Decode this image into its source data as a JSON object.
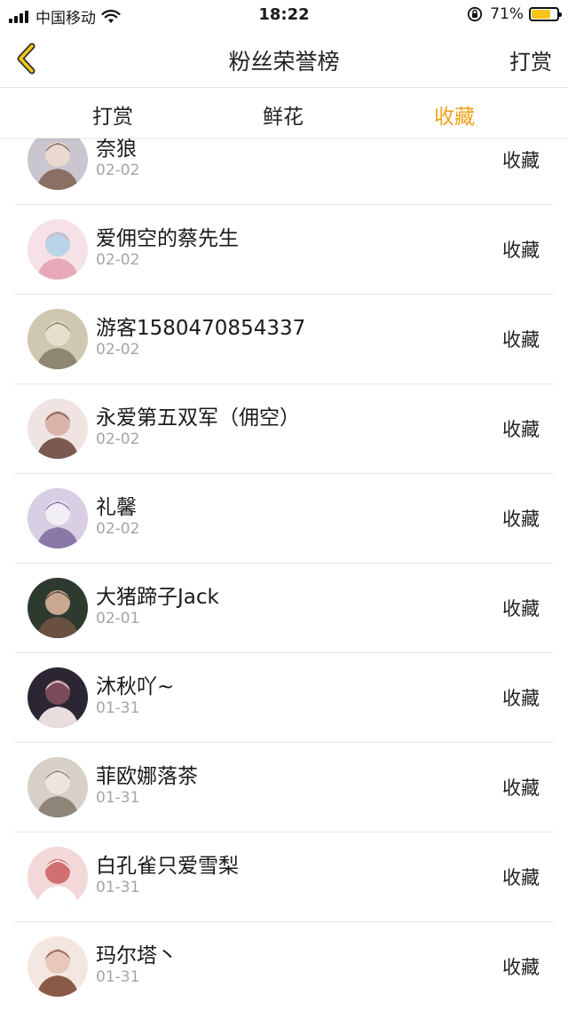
{
  "status_bar": {
    "carrier": "中国移动",
    "time": "18:22",
    "battery_percent": "71%",
    "battery_level": 0.71,
    "signal_bars": 4
  },
  "nav": {
    "title": "粉丝荣誉榜",
    "right_label": "打赏",
    "back_icon": "chevron-left-icon",
    "accent_color": "#f0a21a"
  },
  "tabs": [
    {
      "label": "打赏",
      "active": false
    },
    {
      "label": "鲜花",
      "active": false
    },
    {
      "label": "收藏",
      "active": true
    }
  ],
  "list": {
    "items": [
      {
        "name": "奈狼",
        "date": "02-02",
        "action": "收藏"
      },
      {
        "name": "爱佣空的蔡先生",
        "date": "02-02",
        "action": "收藏"
      },
      {
        "name": "游客1580470854337",
        "date": "02-02",
        "action": "收藏"
      },
      {
        "name": "永爱第五双军（佣空）",
        "date": "02-02",
        "action": "收藏"
      },
      {
        "name": "礼馨",
        "date": "02-02",
        "action": "收藏"
      },
      {
        "name": "大猪蹄子Jack",
        "date": "02-01",
        "action": "收藏"
      },
      {
        "name": "沐秋吖~",
        "date": "01-31",
        "action": "收藏"
      },
      {
        "name": "菲欧娜落茶",
        "date": "01-31",
        "action": "收藏"
      },
      {
        "name": "白孔雀只爱雪梨",
        "date": "01-31",
        "action": "收藏"
      },
      {
        "name": "玛尔塔丶",
        "date": "01-31",
        "action": "收藏"
      }
    ]
  }
}
